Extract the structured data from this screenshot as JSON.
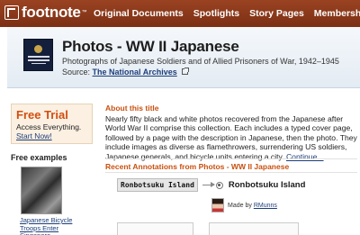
{
  "brand": {
    "name": "footnote",
    "tm": "™"
  },
  "nav": [
    {
      "label": "Original Documents"
    },
    {
      "label": "Spotlights"
    },
    {
      "label": "Story Pages"
    },
    {
      "label": "Memberships"
    }
  ],
  "header": {
    "title": "Photos - WW II Japanese",
    "subtitle": "Photographs of Japanese Soldiers and of Allied Prisoners of War, 1942–1945",
    "source_label": "Source:",
    "source_link": "The National Archives"
  },
  "sidebar": {
    "trial_title": "Free Trial",
    "trial_sub": "Access Everything.",
    "trial_link": "Start Now!",
    "free_examples_label": "Free examples",
    "example_caption": "Japanese Bicycle Troops Enter Singapore"
  },
  "main": {
    "about_heading": "About this title",
    "about_text": "Nearly fifty black and white photos recovered from the Japanese after World War II comprise this collection. Each includes a typed cover page, followed by a page with the description in Japanese, then the photo. They include images as diverse as flamethrowers, surrendering US soldiers, Japanese generals, and bicycle units entering a city.",
    "continue_link": "Continue...",
    "annotations_heading": "Recent Annotations from Photos - WW II Japanese",
    "annotation_crop": "Ronbotsuku Island",
    "annotation_title": "Ronbotsuku Island",
    "made_by_label": "Made by",
    "made_by_user": "RMunns"
  },
  "colors": {
    "nav_bg": "#8d3a1c",
    "accent_orange": "#c8500f",
    "link_blue": "#1d3e7a",
    "header_bg": "#e9eff5"
  }
}
